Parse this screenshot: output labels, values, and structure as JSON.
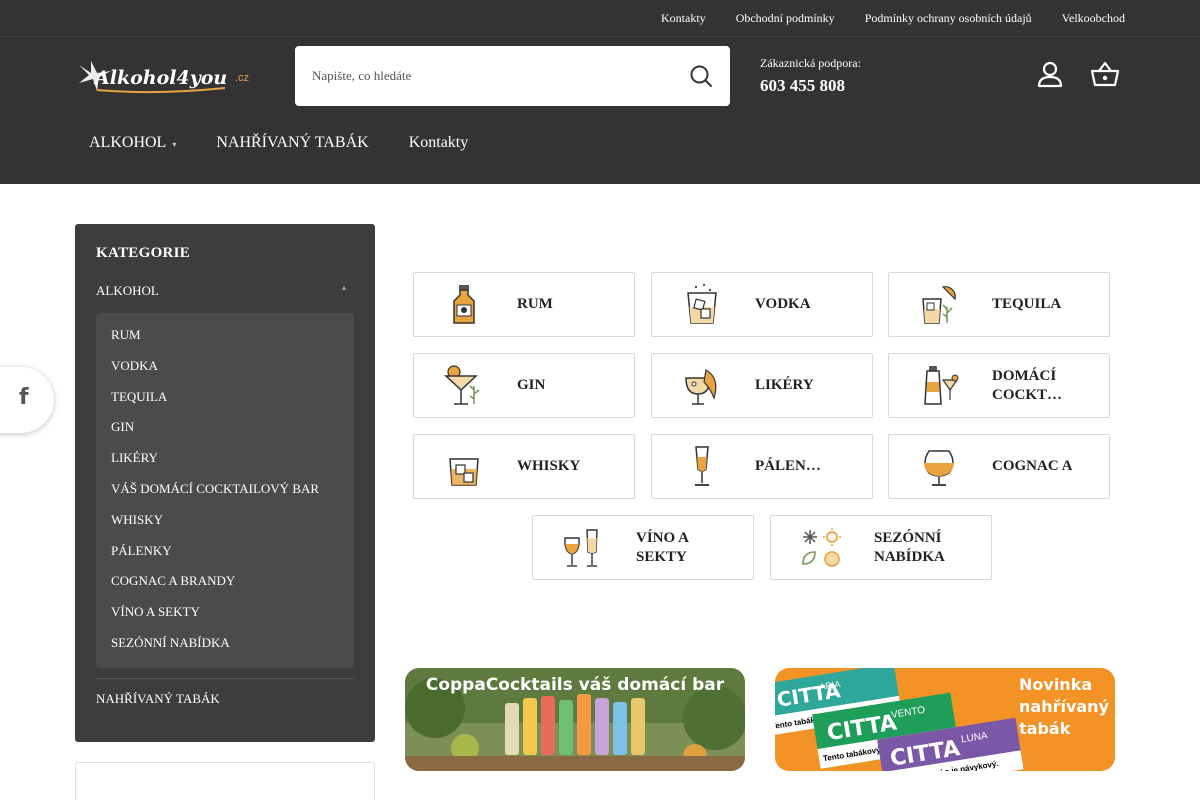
{
  "top_links": [
    "Kontakty",
    "Obchodní podmínky",
    "Podmínky ochrany osobních údajů",
    "Velkoobchod"
  ],
  "logo": {
    "text": "Alkohol4you",
    "suffix": ".cz",
    "accent": "#e9a33f"
  },
  "search": {
    "placeholder": "Napište, co hledáte"
  },
  "support": {
    "label": "Zákaznická podpora:",
    "phone": "603 455 808"
  },
  "main_nav": [
    {
      "label": "ALKOHOL"
    },
    {
      "label": "NAHŘÍVANÝ TABÁK"
    },
    {
      "label": "Kontakty"
    }
  ],
  "sidebar": {
    "title": "KATEGORIE",
    "parent": "ALKOHOL",
    "items": [
      "RUM",
      "VODKA",
      "TEQUILA",
      "GIN",
      "LIKÉRY",
      "VÁŠ DOMÁCÍ COCKTAILOVÝ BAR",
      "WHISKY",
      "PÁLENKY",
      "COGNAC A BRANDY",
      "VÍNO A SEKTY",
      "SEZÓNNÍ NABÍDKA"
    ],
    "bottom": "NAHŘÍVANÝ TABÁK"
  },
  "categories": [
    {
      "label": "RUM",
      "icon": "rum-bottle-icon"
    },
    {
      "label": "VODKA",
      "icon": "vodka-glass-icon"
    },
    {
      "label": "TEQUILA",
      "icon": "tequila-icon"
    },
    {
      "label": "GIN",
      "icon": "gin-cocktail-icon"
    },
    {
      "label": "LIKÉRY",
      "icon": "liqueur-icon"
    },
    {
      "label": "DOMÁCÍ COCKT…",
      "icon": "cocktail-shaker-icon"
    },
    {
      "label": "WHISKY",
      "icon": "whisky-glass-icon"
    },
    {
      "label": "PÁLEN…",
      "icon": "palenky-glass-icon"
    },
    {
      "label": "COGNAC A",
      "icon": "cognac-glass-icon"
    },
    {
      "label": "VÍNO A SEKTY",
      "icon": "wine-glasses-icon"
    },
    {
      "label": "SEZÓNNÍ NABÍDKA",
      "icon": "seasons-icon"
    }
  ],
  "banners": {
    "left": {
      "title": "CoppaCocktails váš domácí bar"
    },
    "right": {
      "headline": "Novinka nahřívaný tabák",
      "headline_lines": [
        "Novinka",
        "nahřívaný",
        "tabák"
      ],
      "products": [
        "ARIA",
        "VENTO",
        "LUNA"
      ],
      "brand": "CITTA",
      "warnings": [
        "Tento tabákový výrobek škodí",
        "Vašemu zdraví a je návykový."
      ]
    }
  },
  "social": {
    "icon": "facebook-icon",
    "glyph": "f"
  },
  "colors": {
    "header_bg": "#333333",
    "sidebar_bg": "#3d3d3d",
    "accent": "#e9a33f",
    "banner_orange": "#f39325"
  }
}
